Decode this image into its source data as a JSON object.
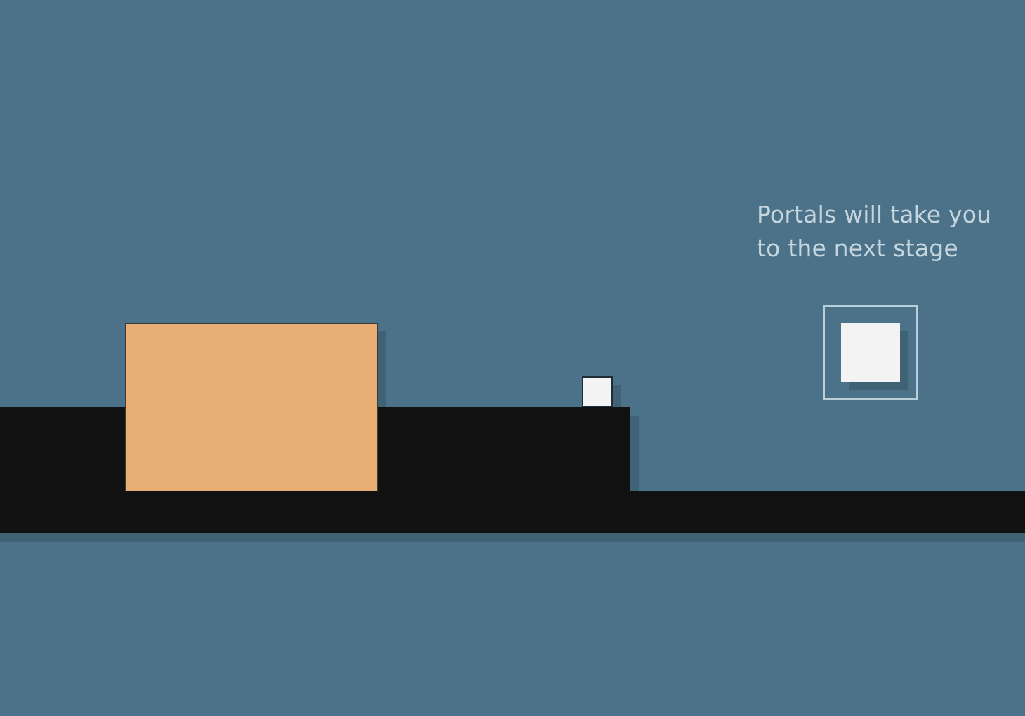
{
  "hint": {
    "line1": "Portals will take you",
    "line2": "to the next stage"
  },
  "colors": {
    "background": "#4b7288",
    "ground": "#111111",
    "shadow": "#3f6275",
    "crate": "#e8ae73",
    "player": "#f3f3f3",
    "portal_frame": "#b9cfd9",
    "hint_text": "#c5d6de"
  },
  "entities": {
    "player": "white square player",
    "crate": "orange pushable crate",
    "portal": "white square portal in frame"
  }
}
